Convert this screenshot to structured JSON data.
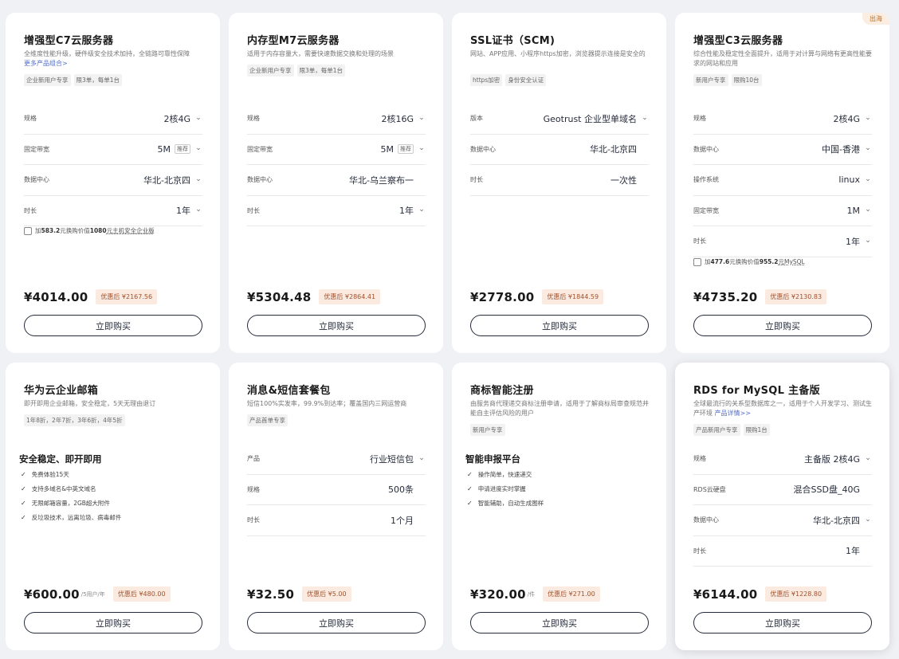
{
  "cards": [
    {
      "title": "增强型C7云服务器",
      "desc": "全维度性能升级，硬件级安全技术加持，全链路可靠性保障",
      "more": "更多产品组合>",
      "tags": [
        "企业新用户专享",
        "限3单，每单1台"
      ],
      "rows": [
        {
          "label": "规格",
          "value": "2核4G"
        },
        {
          "label": "固定带宽",
          "value": "5M",
          "badge": "推荐"
        },
        {
          "label": "数据中心",
          "value": "华北-北京四"
        },
        {
          "label": "时长",
          "value": "1年"
        }
      ],
      "addon": {
        "pre": "加",
        "amount": "583.2",
        "mid": "元换购价值",
        "value": "1080",
        "post": "元主机安全企业版"
      },
      "price": "¥4014.00",
      "discount": "优惠后 ¥2167.56",
      "button": "立即购买"
    },
    {
      "title": "内存型M7云服务器",
      "desc": "适用于内存容量大，需要快速数据交换和处理的场景",
      "tags": [
        "企业新用户专享",
        "限3单，每单1台"
      ],
      "rows": [
        {
          "label": "规格",
          "value": "2核16G"
        },
        {
          "label": "固定带宽",
          "value": "5M",
          "badge": "推荐"
        },
        {
          "label": "数据中心",
          "value": "华北-乌兰察布一"
        },
        {
          "label": "时长",
          "value": "1年"
        }
      ],
      "price": "¥5304.48",
      "discount": "优惠后 ¥2864.41",
      "button": "立即购买"
    },
    {
      "title": "SSL证书（SCM)",
      "desc": "网站、APP应用、小程序https加密，浏览器提示连接是安全的",
      "tags": [
        "https加密",
        "身份安全认证"
      ],
      "rows": [
        {
          "label": "版本",
          "value": "Geotrust 企业型单域名"
        },
        {
          "label": "数据中心",
          "value": "华北-北京四"
        },
        {
          "label": "时长",
          "value": "一次性"
        }
      ],
      "price": "¥2778.00",
      "discount": "优惠后 ¥1844.59",
      "button": "立即购买"
    },
    {
      "title": "增强型C3云服务器",
      "corner": "出海",
      "desc": "综合性能及稳定性全面提升，适用于对计算与网络有更高性能要求的网站和应用",
      "tags": [
        "新用户专享",
        "限购10台"
      ],
      "rows": [
        {
          "label": "规格",
          "value": "2核4G"
        },
        {
          "label": "数据中心",
          "value": "中国-香港"
        },
        {
          "label": "操作系统",
          "value": "linux"
        },
        {
          "label": "固定带宽",
          "value": "1M"
        },
        {
          "label": "时长",
          "value": "1年"
        }
      ],
      "addon": {
        "pre": "加",
        "amount": "477.6",
        "mid": "元换购价值",
        "value": "955.2",
        "post": "元MySQL"
      },
      "price": "¥4735.20",
      "discount": "优惠后 ¥2130.83",
      "button": "立即购买"
    },
    {
      "title": "华为云企业邮箱",
      "desc": "即开即用企业邮箱，安全稳定，5天无理由退订",
      "tags": [
        "1年8折，2年7折，3年6折，4年5折"
      ],
      "feature_title": "安全稳定、即开即用",
      "features": [
        "免费体验15天",
        "支持多域名&中英文域名",
        "无限邮箱容量，2GB超大附件",
        "反垃圾技术，远离垃圾、病毒邮件"
      ],
      "price": "¥600.00",
      "unit": "/5用户/年",
      "discount": "优惠后 ¥480.00",
      "button": "立即购买"
    },
    {
      "title": "消息&短信套餐包",
      "desc": "短信100%实发率，99.9%到达率；覆盖国内三网运营商",
      "tags": [
        "产品首单专享"
      ],
      "rows": [
        {
          "label": "产品",
          "value": "行业短信包"
        },
        {
          "label": "规格",
          "value": "500条"
        },
        {
          "label": "时长",
          "value": "1个月"
        }
      ],
      "price": "¥32.50",
      "discount": "优惠后 ¥5.00",
      "button": "立即购买"
    },
    {
      "title": "商标智能注册",
      "desc": "由服务商代理递交商标注册申请，适用于了解商标局审查规范并能自主评估风险的用户",
      "tags": [
        "新用户专享"
      ],
      "feature_title": "智能申报平台",
      "features": [
        "操作简单，快速递交",
        "申请进度实时掌握",
        "智能辅助，自动生成图样"
      ],
      "price": "¥320.00",
      "unit": "/件",
      "discount": "优惠后 ¥271.00",
      "button": "立即购买"
    },
    {
      "title": "RDS for MySQL 主备版",
      "desc": "全球最流行的关系型数据库之一，适用于个人开发学习、测试生产环境",
      "more": "产品详情>>",
      "tags": [
        "产品新用户专享",
        "限购1台"
      ],
      "rows": [
        {
          "label": "规格",
          "value": "主备版 2核4G"
        },
        {
          "label": "RDS云硬盘",
          "value": "混合SSD盘_40G"
        },
        {
          "label": "数据中心",
          "value": "华北-北京四"
        },
        {
          "label": "时长",
          "value": "1年"
        }
      ],
      "price": "¥6144.00",
      "discount": "优惠后 ¥1228.80",
      "button": "立即购买"
    }
  ]
}
